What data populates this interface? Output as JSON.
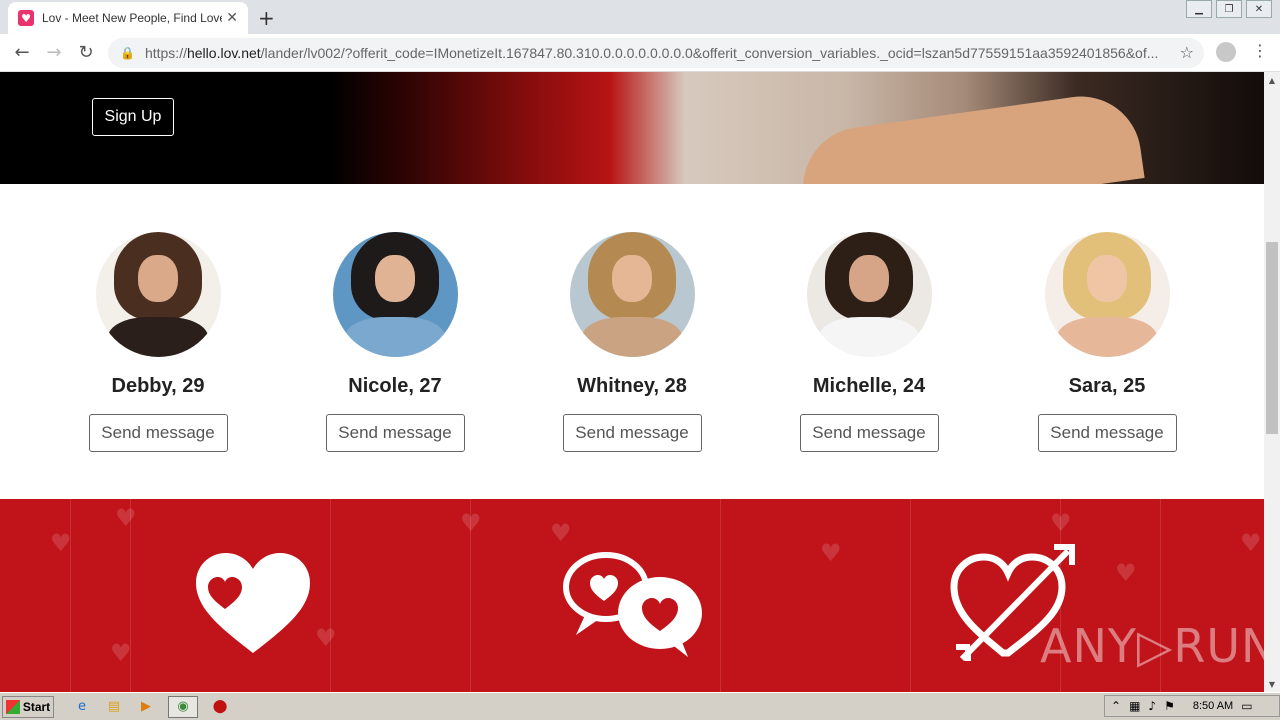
{
  "browser": {
    "tab_title": "Lov - Meet New People, Find Love, C",
    "tab_close": "✕",
    "new_tab": "+",
    "url_scheme": "https://",
    "url_host": "hello.lov.net",
    "url_path": "/lander/lv002/?offerit_code=IMonetizeIt.167847.80.310.0.0.0.0.0.0.0.0&offerit_conversion_variables._ocid=lszan5d77559151aa3592401856&of..."
  },
  "hero": {
    "signup_label": "Sign Up"
  },
  "profiles": [
    {
      "name": "Debby, 29",
      "button": "Send message"
    },
    {
      "name": "Nicole, 27",
      "button": "Send message"
    },
    {
      "name": "Whitney, 28",
      "button": "Send message"
    },
    {
      "name": "Michelle, 24",
      "button": "Send message"
    },
    {
      "name": "Sara, 25",
      "button": "Send message"
    }
  ],
  "features": {
    "icons": [
      "heart-icon",
      "chat-hearts-icon",
      "heart-arrow-icon"
    ]
  },
  "watermark": "ANY▷RUN",
  "taskbar": {
    "start_label": "Start",
    "clock": "8:50 AM"
  },
  "colors": {
    "red_band": "#c0141a",
    "chrome_tab_strip": "#dee1e6",
    "lov_brand": "#e8336d"
  }
}
